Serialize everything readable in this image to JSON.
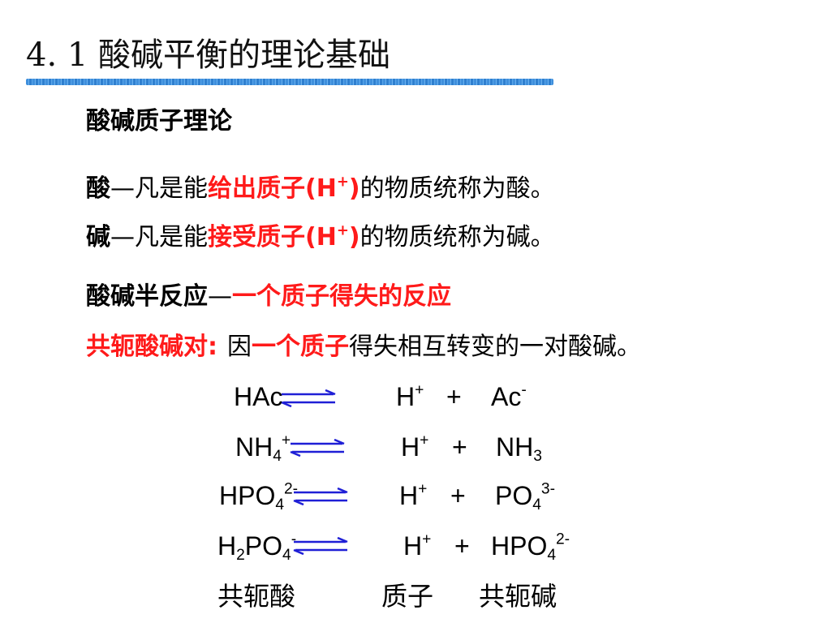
{
  "slide": {
    "title": "4. 1  酸碱平衡的理论基础",
    "subtitle": "酸碱质子理论"
  },
  "acid_def": {
    "term": "酸",
    "dash": "—凡是能",
    "highlight": "给出质子(H",
    "highlight_sup": "+",
    "highlight_end": ")",
    "rest": "的物质统称为酸。"
  },
  "base_def": {
    "term": "碱",
    "dash": "—凡是能",
    "highlight": "接受质子(H",
    "highlight_sup": "+",
    "highlight_end": ")",
    "rest": "的物质统称为碱。"
  },
  "half_reaction": {
    "term": "酸碱半反应",
    "dash": "—",
    "highlight": "一个质子得失的反应"
  },
  "conjugate_pair": {
    "term": "共轭酸碱对:",
    "pre": "因",
    "highlight": "一个质子",
    "rest": "得失相互转变的一对酸碱。"
  },
  "equilibria": [
    {
      "acid": "HAc",
      "proton": "H",
      "proton_sup": "+",
      "plus": "+",
      "base": "Ac",
      "base_sup": "-"
    },
    {
      "acid": "NH",
      "acid_sub": "4",
      "acid_sup": "+",
      "proton": "H",
      "proton_sup": "+",
      "plus": "+",
      "base": "NH",
      "base_sub": "3"
    },
    {
      "acid": "HPO",
      "acid_sub": "4",
      "acid_sup": "2-",
      "proton": "H",
      "proton_sup": "+",
      "plus": "+",
      "base": "PO",
      "base_sub": "4",
      "base_sup": "3-"
    },
    {
      "acid_pre": "H",
      "acid_pre_sub": "2",
      "acid": "PO",
      "acid_sub": "4",
      "acid_sup": "-",
      "proton": "H",
      "proton_sup": "+",
      "plus": "+",
      "base": "HPO",
      "base_sub": "4",
      "base_sup": "2-"
    }
  ],
  "column_labels": {
    "acid": "共轭酸",
    "proton": "质子",
    "base": "共轭碱"
  },
  "colors": {
    "highlight": "#ff1a1a",
    "arrow": "#1f1fd6",
    "rule": "#3f8fdc"
  }
}
